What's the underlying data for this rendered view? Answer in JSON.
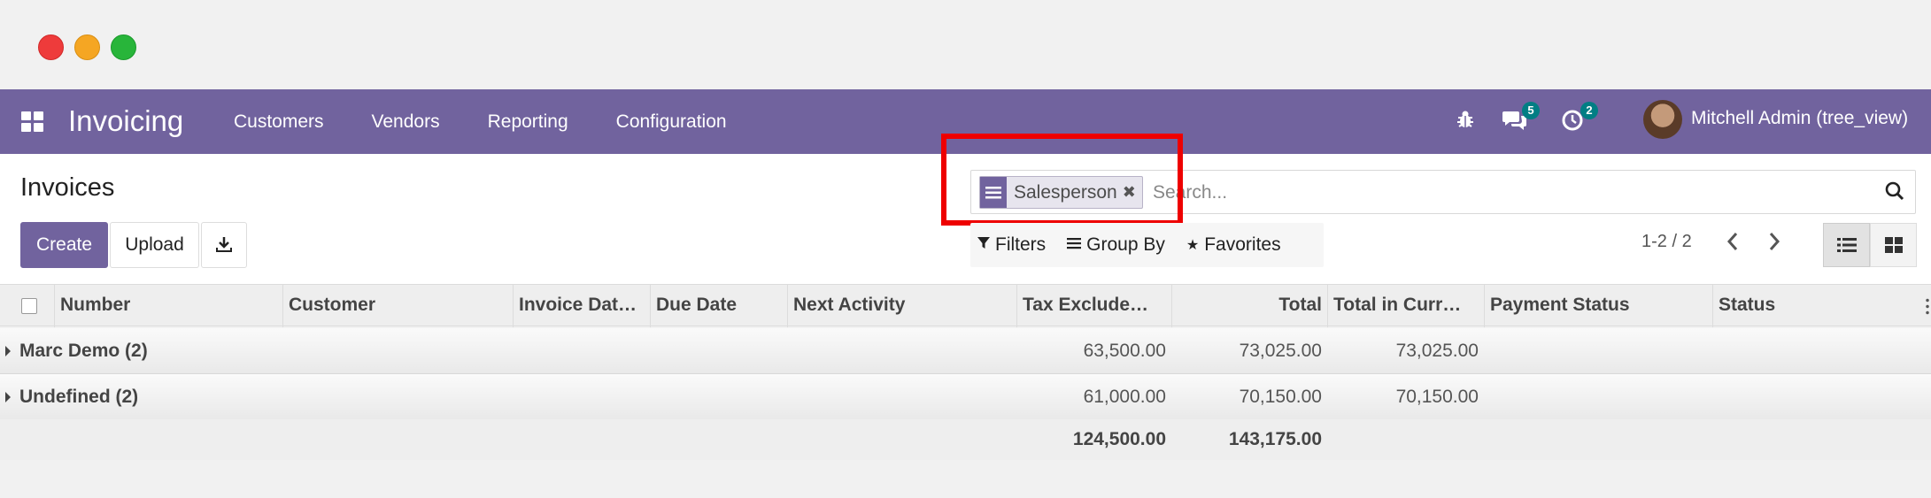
{
  "navbar": {
    "app_title": "Invoicing",
    "menu": [
      "Customers",
      "Vendors",
      "Reporting",
      "Configuration"
    ],
    "messages_count": "5",
    "activities_count": "2",
    "user_name": "Mitchell Admin (tree_view)"
  },
  "control": {
    "breadcrumb": "Invoices",
    "create_label": "Create",
    "upload_label": "Upload",
    "search": {
      "facet_label": "Salesperson",
      "placeholder": "Search..."
    },
    "filters_label": "Filters",
    "group_by_label": "Group By",
    "favorites_label": "Favorites",
    "pager": "1-2 / 2"
  },
  "table": {
    "columns": [
      "Number",
      "Customer",
      "Invoice Dat…",
      "Due Date",
      "Next Activity",
      "Tax Exclude…",
      "Total",
      "Total in Curr…",
      "Payment Status",
      "Status"
    ],
    "groups": [
      {
        "label": "Marc Demo (2)",
        "tax_excluded": "63,500.00",
        "total": "73,025.00",
        "total_currency": "73,025.00"
      },
      {
        "label": "Undefined (2)",
        "tax_excluded": "61,000.00",
        "total": "70,150.00",
        "total_currency": "70,150.00"
      }
    ],
    "totals": {
      "tax_excluded": "124,500.00",
      "total": "143,175.00"
    }
  },
  "colors": {
    "brand": "#71639e",
    "badge": "#017e84",
    "highlight": "#ee0000"
  }
}
